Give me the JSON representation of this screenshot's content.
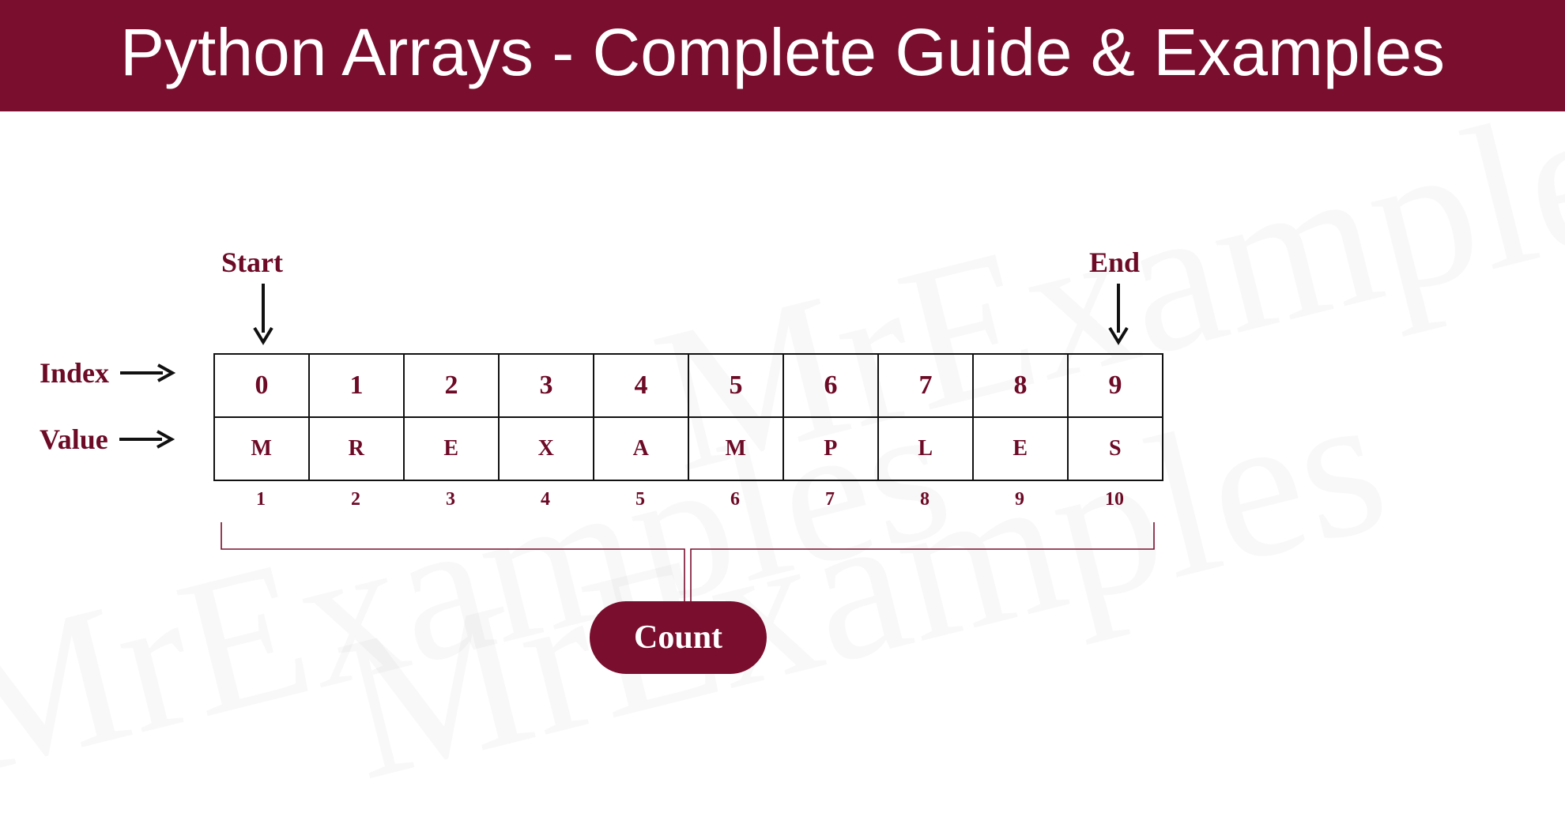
{
  "header": {
    "title": "Python Arrays - Complete Guide & Examples"
  },
  "labels": {
    "index": "Index",
    "value": "Value",
    "start": "Start",
    "end": "End",
    "count": "Count"
  },
  "array": {
    "indices": [
      "0",
      "1",
      "2",
      "3",
      "4",
      "5",
      "6",
      "7",
      "8",
      "9"
    ],
    "values": [
      "M",
      "R",
      "E",
      "X",
      "A",
      "M",
      "P",
      "L",
      "E",
      "S"
    ],
    "counts": [
      "1",
      "2",
      "3",
      "4",
      "5",
      "6",
      "7",
      "8",
      "9",
      "10"
    ]
  },
  "watermark": "MrExamples",
  "colors": {
    "brand": "#7a0e2e",
    "text_dark": "#6d0a26"
  }
}
